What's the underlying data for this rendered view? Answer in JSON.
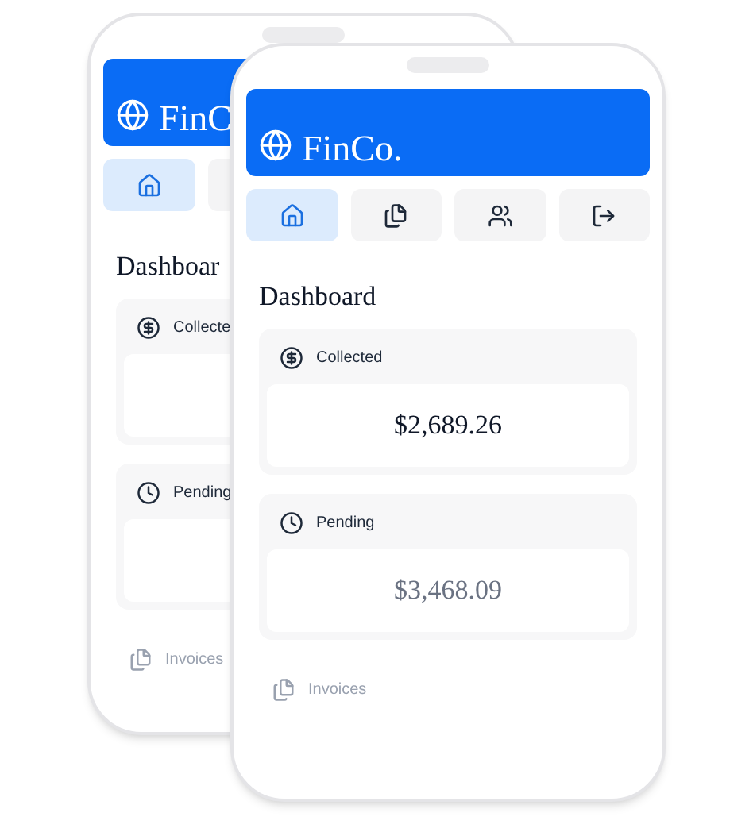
{
  "back_phone": {
    "brand": "FinC",
    "tabs": [
      {
        "kind": "home",
        "selected": true
      },
      {
        "kind": "blank",
        "selected": false
      }
    ],
    "heading": "Dashboar",
    "cards": [
      {
        "kind": "collected",
        "label": "Collecte"
      },
      {
        "kind": "pending",
        "label": "Pending"
      }
    ],
    "footer_item": {
      "kind": "invoices",
      "label": "Invoices"
    }
  },
  "front_phone": {
    "brand": "FinCo.",
    "tabs": [
      {
        "kind": "home",
        "selected": true
      },
      {
        "kind": "documents",
        "selected": false
      },
      {
        "kind": "users",
        "selected": false
      },
      {
        "kind": "logout",
        "selected": false
      }
    ],
    "heading": "Dashboard",
    "cards": [
      {
        "kind": "collected",
        "label": "Collected",
        "value": "$2,689.26"
      },
      {
        "kind": "pending",
        "label": "Pending",
        "value": "$3,468.09"
      }
    ],
    "footer_item": {
      "kind": "invoices",
      "label": "Invoices"
    }
  }
}
